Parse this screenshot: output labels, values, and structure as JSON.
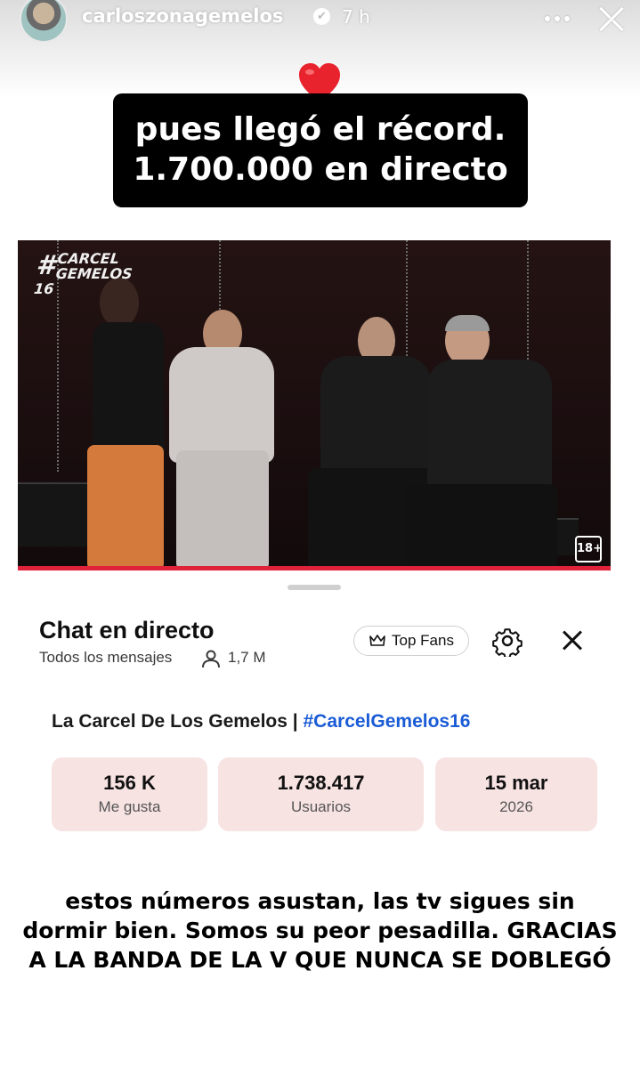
{
  "story": {
    "username": "carloszonagemelos",
    "time": "7 h",
    "caption_line1": "pues llegó el récord.",
    "caption_line2": "1.700.000 en directo",
    "bottom_line1": "estos números asustan, las tv sigues sin",
    "bottom_line2": "dormir bien. Somos su peor pesadilla. GRACIAS",
    "bottom_line3": "A LA BANDA DE LA V QUE NUNCA SE DOBLEGÓ"
  },
  "video": {
    "logo_line1": "CARCEL",
    "logo_line2": "GEMELOS 16",
    "logo_hash": "#",
    "rating": "18+"
  },
  "chat": {
    "title": "Chat en directo",
    "filter": "Todos los mensajes",
    "viewers": "1,7 M",
    "top_fans": "Top Fans",
    "stream_title": "La Carcel De Los Gemelos | ",
    "stream_tag": "#CarcelGemelos16",
    "stats": [
      {
        "value": "156 K",
        "label": "Me gusta"
      },
      {
        "value": "1.738.417",
        "label": "Usuarios"
      },
      {
        "value": "15 mar",
        "label": "2026"
      }
    ]
  },
  "colors": {
    "accent_red": "#e0213a",
    "hashtag_blue": "#1a5bd6",
    "stat_bg": "#f8e3e3",
    "heart": "#e8232d"
  },
  "icons": [
    "heart-icon",
    "verified-badge-icon",
    "more-options-icon",
    "close-icon",
    "person-icon",
    "crown-icon",
    "gear-icon"
  ]
}
